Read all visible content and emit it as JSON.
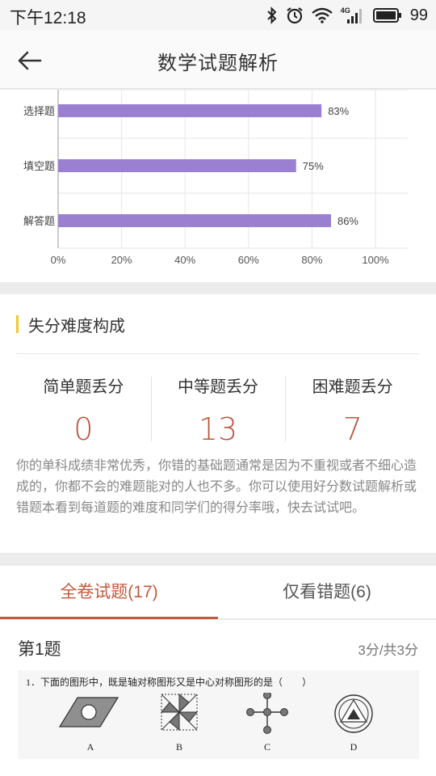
{
  "status_bar": {
    "time": "下午12:18",
    "battery": "99",
    "network_label": "4G"
  },
  "nav": {
    "title": "数学试题解析",
    "back_icon": "arrow-left-icon"
  },
  "chart_data": {
    "type": "bar",
    "orientation": "horizontal",
    "categories": [
      "选择题",
      "填空题",
      "解答题"
    ],
    "values": [
      83,
      75,
      86
    ],
    "value_labels": [
      "83%",
      "75%",
      "86%"
    ],
    "xlim": [
      0,
      100
    ],
    "x_ticks": [
      "0%",
      "20%",
      "40%",
      "60%",
      "80%",
      "100%"
    ],
    "grid": true,
    "bar_color": "#9b7fd0"
  },
  "difficulty": {
    "title": "失分难度构成",
    "accent_color": "#f2c733",
    "stats": [
      {
        "label": "简单题丢分",
        "value": "0"
      },
      {
        "label": "中等题丢分",
        "value": "13"
      },
      {
        "label": "困难题丢分",
        "value": "7"
      }
    ],
    "description": "你的单科成绩非常优秀，你错的基础题通常是因为不重视或者不细心造成的，你都不会的难题能对的人也不多。你可以使用好分数试题解析或错题本看到每道题的难度和同学们的得分率哦，快去试试吧。"
  },
  "tabs": [
    {
      "label": "全卷试题(17)",
      "active": true
    },
    {
      "label": "仅看错题(6)",
      "active": false
    }
  ],
  "accent_color": "#c15a3c",
  "question": {
    "title": "第1题",
    "score": "3分/共3分",
    "text": "1．下面的图形中，既是轴对称图形又是中心对称图形的是（　　）",
    "options": [
      "A",
      "B",
      "C",
      "D"
    ]
  }
}
